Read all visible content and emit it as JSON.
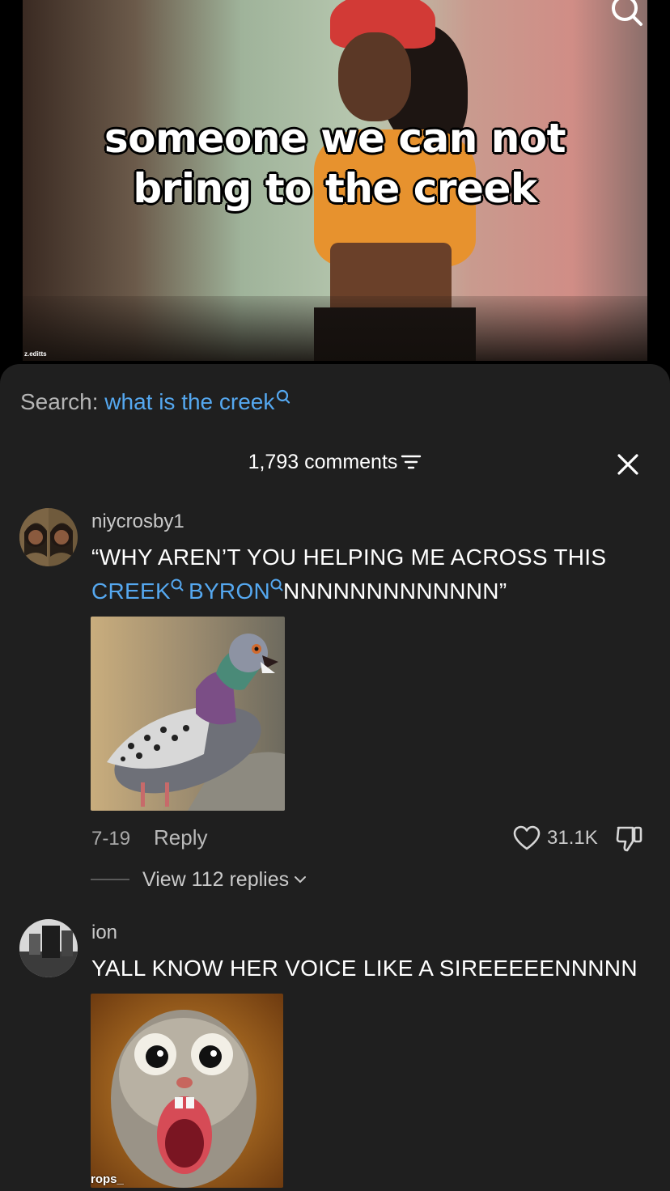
{
  "video": {
    "caption_line1": "someone we can not",
    "caption_line2": "bring to the creek",
    "watermark": "z.editts"
  },
  "search": {
    "label": "Search:",
    "term": "what is the creek"
  },
  "comments": {
    "count_label": "1,793 comments"
  },
  "comment_list": [
    {
      "username": "niycrosby1",
      "text_prefix": "“WHY AREN’T YOU HELPING ME ACROSS THIS",
      "link1": "CREEK",
      "link2": "BYRON",
      "text_suffix": "NNNNNNNNNNNNN”",
      "date": "7-19",
      "reply_label": "Reply",
      "likes": "31.1K",
      "view_replies": "View 112 replies"
    },
    {
      "username": "ion",
      "text": "YALL KNOW HER VOICE LIKE A SIREEEEENNNNN",
      "attachment_caption": "rops_"
    }
  ],
  "colors": {
    "sheet_bg": "#1f1f1f",
    "link": "#55a8f0",
    "muted": "#a9a9a9"
  },
  "icons": [
    "search-icon",
    "filter-icon",
    "close-icon",
    "heart-icon",
    "dislike-icon",
    "chevron-down-icon"
  ]
}
